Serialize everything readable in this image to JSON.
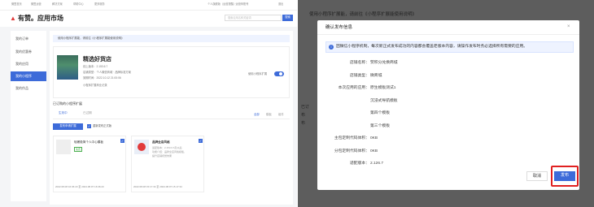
{
  "left": {
    "nav": {
      "links": [
        "微盟首页",
        "微盟运营",
        "解决方案",
        "帮助中心",
        "更多服务"
      ],
      "account": "个人旗舰版（运营提醒）·运营商账号",
      "exit": "退出"
    },
    "header": {
      "logo_text": "有赞。应用市场",
      "search_placeholder": "搜索应用名称关键词",
      "search_button": "搜索"
    },
    "sidebar": [
      "我的订单",
      "我的优惠券",
      "我的应用",
      "我的小程序",
      "我的作品"
    ],
    "sidebar_active_index": 3,
    "notice": "使用小程序扩展能，请前往《小程序扩展能使用说明》",
    "product": {
      "name": "精选好货店",
      "version": "线上版本：2.153.6.7",
      "type": "店铺类型：个人微信商城 · 品牌标准方案",
      "expire": "到期时间：2022.10.12 21:00:06",
      "link": "小程序扩展商业记录",
      "toggle_label": "使用小程序扩展"
    },
    "section_title": "已订购的小程序扩展",
    "tabs": [
      "生效中",
      "已过期"
    ],
    "right_tabs": [
      "全部",
      "模板",
      "组件"
    ],
    "publish_button": "发布申请扩展",
    "checkbox_label": "重新发布正式版",
    "tile1": {
      "title": "轻奢极简个人中心模板",
      "badge": "免费",
      "date": "2022.08.08 16:36:23 至 2024.08.07 16:36:23"
    },
    "tile2": {
      "title": "品牌全店风格",
      "line1": "适配版本：2.153.6.6及以后",
      "line2": "功能介绍：品牌全店风格模板，",
      "line3": "提升店铺视觉效果",
      "date": "2022.08.08 15:17:34 至 2024.08.07 15:17:34"
    }
  },
  "right": {
    "background_text": "使用小程序扩展能，请前往《小程序扩展能使用说明》",
    "background_text2": "已订",
    "background_text3": "布",
    "background_text4": "布",
    "modal": {
      "title": "确认发布信息",
      "close": "×",
      "info": "因微信小程序机制，每次新正式发布成功的内容都会覆盖老版本内容，请操作发布时务必选择所有需要的应用。",
      "rows": [
        {
          "label": "店铺名称：",
          "value": "赞积分兑换商城"
        },
        {
          "label": "店铺类型：",
          "value": "微商城"
        },
        {
          "label": "本次应用的应用：",
          "value": "原生模板测试1"
        },
        {
          "label": "",
          "value": "沉浸式导航模板"
        },
        {
          "label": "",
          "value": "第四个模板"
        },
        {
          "label": "",
          "value": "第三个模板"
        },
        {
          "label": "主包定制代码体积：",
          "value": "0KB"
        },
        {
          "label": "分包定制代码体积：",
          "value": "0KB"
        },
        {
          "label": "适配版本：",
          "value": "2.126.7"
        }
      ],
      "cancel": "取消",
      "confirm": "发布"
    }
  },
  "colors": {
    "accent": "#3d6bd9",
    "highlight": "#e02020",
    "overlay": "#5d5d5d"
  }
}
